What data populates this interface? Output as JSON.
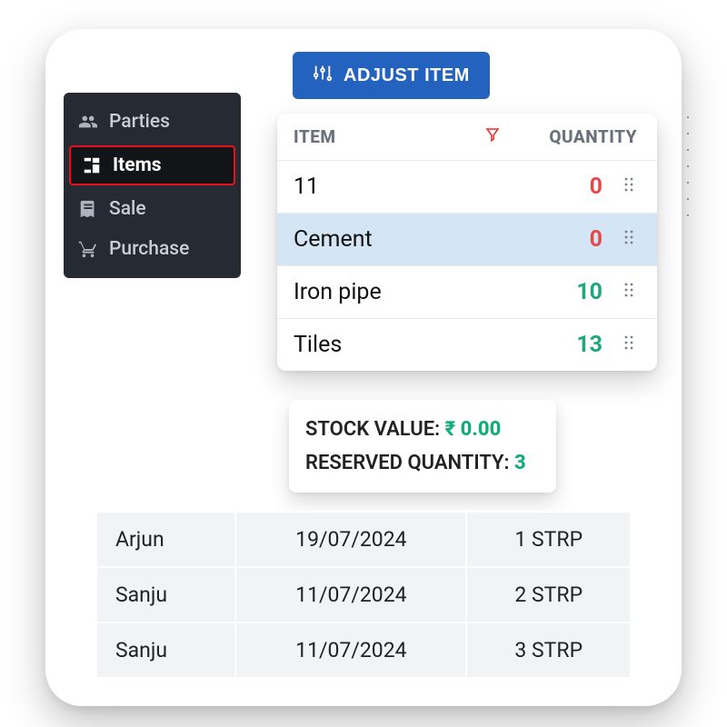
{
  "sidebar": {
    "items": [
      {
        "label": "Parties",
        "icon": "people-icon",
        "active": false
      },
      {
        "label": "Items",
        "icon": "box-icon",
        "active": true
      },
      {
        "label": "Sale",
        "icon": "receipt-icon",
        "active": false
      },
      {
        "label": "Purchase",
        "icon": "cart-icon",
        "active": false
      }
    ]
  },
  "adjust_button": {
    "label": "ADJUST ITEM"
  },
  "items_table": {
    "headers": {
      "item": "ITEM",
      "quantity": "QUANTITY"
    },
    "rows": [
      {
        "name": "11",
        "qty": "0",
        "qty_color": "red",
        "selected": false
      },
      {
        "name": "Cement",
        "qty": "0",
        "qty_color": "red",
        "selected": true
      },
      {
        "name": "Iron pipe",
        "qty": "10",
        "qty_color": "green",
        "selected": false
      },
      {
        "name": "Tiles",
        "qty": "13",
        "qty_color": "green",
        "selected": false
      }
    ]
  },
  "stock_box": {
    "stock_label": "STOCK VALUE: ",
    "stock_value": "₹ 0.00",
    "reserved_label": "RESERVED QUANTITY: ",
    "reserved_value": "3"
  },
  "ledger": {
    "rows": [
      {
        "name": "Arjun",
        "date": "19/07/2024",
        "amount": "1 STRP"
      },
      {
        "name": "Sanju",
        "date": "11/07/2024",
        "amount": "2 STRP"
      },
      {
        "name": "Sanju",
        "date": "11/07/2024",
        "amount": "3 STRP"
      }
    ]
  }
}
